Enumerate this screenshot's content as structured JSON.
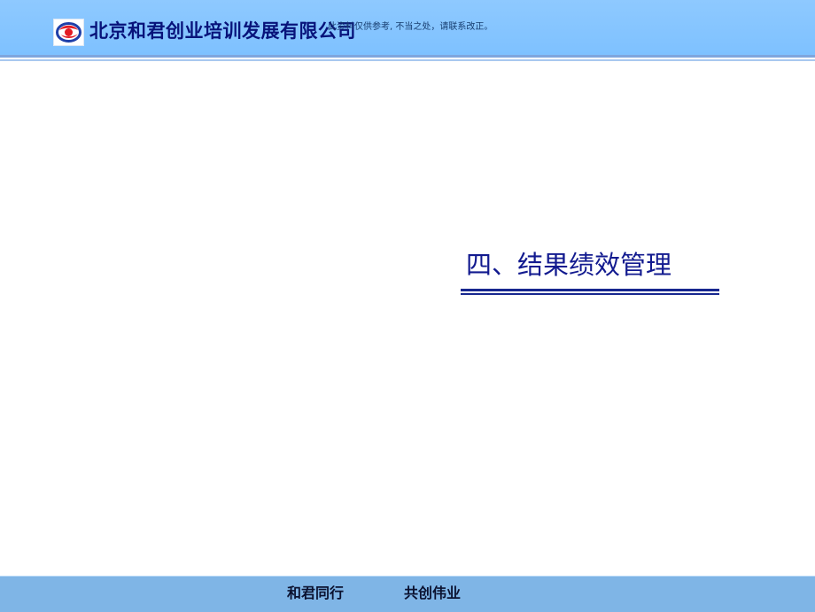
{
  "header": {
    "company_name": "北京和君创业培训发展有限公司",
    "disclaimer": "此资料仅供参考, 不当之处，请联系改正。"
  },
  "main": {
    "section_title": "四、结果绩效管理"
  },
  "footer": {
    "slogan_left": "和君同行",
    "slogan_right": "共创伟业"
  },
  "colors": {
    "header_blue": "#8ec9ff",
    "title_blue": "#121a8f",
    "footer_blue": "#7fb5e6",
    "logo_red": "#e31b23",
    "logo_blue": "#1f3fa8"
  },
  "icons": {
    "logo": "company-logo-icon"
  }
}
